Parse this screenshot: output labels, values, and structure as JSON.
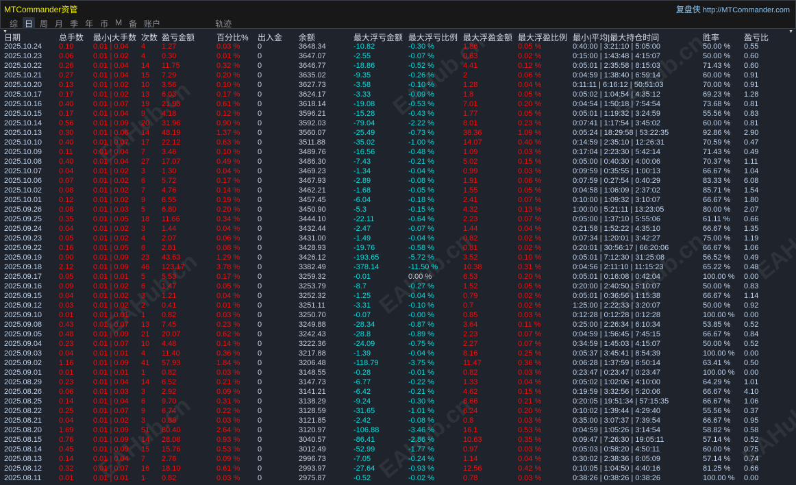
{
  "app": {
    "title": "MTCommander资管",
    "brand_cn": "复盘侠",
    "brand_url": "http://MTCommander.com",
    "watermark": "EAHub.cn"
  },
  "tabs": [
    {
      "label": "综"
    },
    {
      "label": "日",
      "active": true
    },
    {
      "label": "周"
    },
    {
      "label": "月"
    },
    {
      "label": "季"
    },
    {
      "label": "年"
    },
    {
      "label": "币"
    },
    {
      "label": "M"
    },
    {
      "label": "备"
    },
    {
      "label": "账户"
    },
    {
      "label": "轨迹"
    }
  ],
  "columns": [
    "日期",
    "总手数",
    "最小|大手数",
    "次数",
    "盈亏金额",
    "百分比%",
    "出入金",
    "余额",
    "最大浮亏金额",
    "最大浮亏比例",
    "最大浮盈金额",
    "最大浮盈比例",
    "最小|平均|最大持仓时间",
    "胜率",
    "盈亏比"
  ],
  "colors": {
    "positive": "#ee1111",
    "negative": "#10dcdc",
    "neutral": "#c0d4ee"
  },
  "rows": [
    [
      "2025.10.24",
      "0.10",
      "0.01 | 0.04",
      "4",
      "1.27",
      "0.03 %",
      "0",
      "3648.34",
      "-10.82",
      "-0.30 %",
      "1.86",
      "0.05 %",
      "0:40:00 | 3:21:10 | 5:05:00",
      "50.00 %",
      "0.55"
    ],
    [
      "2025.10.23",
      "0.06",
      "0.01 | 0.02",
      "4",
      "0.30",
      "0.01 %",
      "0",
      "3647.07",
      "-2.55",
      "-0.07 %",
      "0.63",
      "0.02 %",
      "0:15:00 | 1:43:48 | 4:15:07",
      "50.00 %",
      "0.60"
    ],
    [
      "2025.10.22",
      "0.26",
      "0.01 | 0.04",
      "14",
      "11.75",
      "0.32 %",
      "0",
      "3646.77",
      "-18.86",
      "-0.52 %",
      "4.41",
      "0.12 %",
      "0:05:01 | 2:35:58 | 8:15:03",
      "71.43 %",
      "0.60"
    ],
    [
      "2025.10.21",
      "0.27",
      "0.01 | 0.04",
      "15",
      "7.29",
      "0.20 %",
      "0",
      "3635.02",
      "-9.35",
      "-0.26 %",
      "2",
      "0.06 %",
      "0:04:59 | 1:38:40 | 6:59:14",
      "60.00 %",
      "0.91"
    ],
    [
      "2025.10.20",
      "0.13",
      "0.01 | 0.02",
      "10",
      "3.56",
      "0.10 %",
      "0",
      "3627.73",
      "-3.58",
      "-0.10 %",
      "1.28",
      "0.04 %",
      "0:11:11 | 6:16:12 | 50:51:03",
      "70.00 %",
      "0.91"
    ],
    [
      "2025.10.17",
      "0.17",
      "0.01 | 0.02",
      "13",
      "6.03",
      "0.17 %",
      "0",
      "3624.17",
      "-3.33",
      "-0.09 %",
      "1.8",
      "0.05 %",
      "0:05:02 | 1:04:54 | 4:35:12",
      "69.23 %",
      "1.28"
    ],
    [
      "2025.10.16",
      "0.40",
      "0.01 | 0.07",
      "19",
      "21.93",
      "0.61 %",
      "0",
      "3618.14",
      "-19.08",
      "-0.53 %",
      "7.01",
      "0.20 %",
      "0:04:54 | 1:50:18 | 7:54:54",
      "73.68 %",
      "0.81"
    ],
    [
      "2025.10.15",
      "0.17",
      "0.01 | 0.04",
      "9",
      "4.18",
      "0.12 %",
      "0",
      "3596.21",
      "-15.28",
      "-0.43 %",
      "1.77",
      "0.05 %",
      "0:05:01 | 1:19:32 | 3:24:59",
      "55.56 %",
      "0.83"
    ],
    [
      "2025.10.14",
      "0.56",
      "0.01 | 0.09",
      "20",
      "31.96",
      "0.90 %",
      "0",
      "3592.03",
      "-79.04",
      "-2.22 %",
      "8.01",
      "0.23 %",
      "0:07:41 | 1:17:54 | 3:45:02",
      "60.00 %",
      "0.81"
    ],
    [
      "2025.10.13",
      "0.30",
      "0.01 | 0.06",
      "14",
      "48.19",
      "1.37 %",
      "0",
      "3560.07",
      "-25.49",
      "-0.73 %",
      "38.36",
      "1.09 %",
      "0:05:24 | 18:29:58 | 53:22:35",
      "92.86 %",
      "2.90"
    ],
    [
      "2025.10.10",
      "0.40",
      "0.01 | 0.07",
      "17",
      "22.12",
      "0.63 %",
      "0",
      "3511.88",
      "-35.02",
      "-1.00 %",
      "14.07",
      "0.40 %",
      "0:14:59 | 2:35:10 | 12:26:31",
      "70.59 %",
      "0.47"
    ],
    [
      "2025.10.09",
      "0.11",
      "0.01 | 0.04",
      "7",
      "3.46",
      "0.10 %",
      "0",
      "3489.76",
      "-16.56",
      "-0.48 %",
      "1.09",
      "0.03 %",
      "0:17:04 | 2:23:30 | 5:42:14",
      "71.43 %",
      "0.49"
    ],
    [
      "2025.10.08",
      "0.40",
      "0.01 | 0.04",
      "27",
      "17.07",
      "0.49 %",
      "0",
      "3486.30",
      "-7.43",
      "-0.21 %",
      "5.02",
      "0.15 %",
      "0:05:00 | 0:40:30 | 4:00:06",
      "70.37 %",
      "1.11"
    ],
    [
      "2025.10.07",
      "0.04",
      "0.01 | 0.02",
      "3",
      "1.30",
      "0.04 %",
      "0",
      "3469.23",
      "-1.34",
      "-0.04 %",
      "0.99",
      "0.03 %",
      "0:09:59 | 0:35:55 | 1:00:13",
      "66.67 %",
      "1.04"
    ],
    [
      "2025.10.06",
      "0.07",
      "0.01 | 0.02",
      "6",
      "5.72",
      "0.17 %",
      "0",
      "3467.93",
      "-2.89",
      "-0.08 %",
      "1.91",
      "0.06 %",
      "0:07:59 | 0:27:54 | 0:40:29",
      "83.33 %",
      "6.08"
    ],
    [
      "2025.10.02",
      "0.08",
      "0.01 | 0.02",
      "7",
      "4.76",
      "0.14 %",
      "0",
      "3462.21",
      "-1.68",
      "-0.05 %",
      "1.55",
      "0.05 %",
      "0:04:58 | 1:06:09 | 2:37:02",
      "85.71 %",
      "1.54"
    ],
    [
      "2025.10.01",
      "0.12",
      "0.01 | 0.02",
      "9",
      "6.55",
      "0.19 %",
      "0",
      "3457.45",
      "-6.04",
      "-0.18 %",
      "2.41",
      "0.07 %",
      "0:10:00 | 1:09:32 | 3:10:07",
      "66.67 %",
      "1.80"
    ],
    [
      "2025.09.26",
      "0.08",
      "0.01 | 0.03",
      "5",
      "6.80",
      "0.20 %",
      "0",
      "3450.90",
      "-5.3",
      "-0.15 %",
      "4.32",
      "0.13 %",
      "1:00:00 | 5:21:11 | 13:23:05",
      "80.00 %",
      "2.07"
    ],
    [
      "2025.09.25",
      "0.35",
      "0.01 | 0.05",
      "18",
      "11.66",
      "0.34 %",
      "0",
      "3444.10",
      "-22.11",
      "-0.64 %",
      "2.23",
      "0.07 %",
      "0:05:00 | 1:37:10 | 5:55:06",
      "61.11 %",
      "0.66"
    ],
    [
      "2025.09.24",
      "0.04",
      "0.01 | 0.02",
      "3",
      "1.44",
      "0.04 %",
      "0",
      "3432.44",
      "-2.47",
      "-0.07 %",
      "1.44",
      "0.04 %",
      "0:21:58 | 1:52:22 | 4:35:10",
      "66.67 %",
      "1.35"
    ],
    [
      "2025.09.23",
      "0.05",
      "0.01 | 0.02",
      "4",
      "2.07",
      "0.06 %",
      "0",
      "3431.00",
      "-1.49",
      "-0.04 %",
      "0.82",
      "0.02 %",
      "0:07:34 | 1:20:01 | 3:42:27",
      "75.00 %",
      "1.19"
    ],
    [
      "2025.09.22",
      "0.16",
      "0.01 | 0.05",
      "6",
      "2.81",
      "0.08 %",
      "0",
      "3428.93",
      "-19.76",
      "-0.58 %",
      "0.81",
      "0.02 %",
      "0:20:01 | 30:56:17 | 66:20:06",
      "66.67 %",
      "1.06"
    ],
    [
      "2025.09.19",
      "0.90",
      "0.01 | 0.09",
      "23",
      "43.63",
      "1.29 %",
      "0",
      "3426.12",
      "-193.65",
      "-5.72 %",
      "3.52",
      "0.10 %",
      "0:05:01 | 7:12:30 | 31:25:08",
      "56.52 %",
      "0.49"
    ],
    [
      "2025.09.18",
      "2.12",
      "0.01 | 0.09",
      "46",
      "123.17",
      "3.78 %",
      "0",
      "3382.49",
      "-378.14",
      "-11.50 %",
      "10.38",
      "0.31 %",
      "0:04:56 | 2:11:10 | 11:15:23",
      "65.22 %",
      "0.48"
    ],
    [
      "2025.09.17",
      "0.05",
      "0.01 | 0.01",
      "5",
      "5.53",
      "0.17 %",
      "0",
      "3259.32",
      "-0.01",
      "0.00 %",
      "6.53",
      "0.20 %",
      "0:05:01 | 0:16:08 | 0:42:04",
      "100.00 %",
      "0.00"
    ],
    [
      "2025.09.16",
      "0.09",
      "0.01 | 0.02",
      "6",
      "1.47",
      "0.05 %",
      "0",
      "3253.79",
      "-8.7",
      "-0.27 %",
      "1.52",
      "0.05 %",
      "0:20:00 | 2:40:50 | 5:10:07",
      "50.00 %",
      "0.83"
    ],
    [
      "2025.09.15",
      "0.04",
      "0.01 | 0.02",
      "3",
      "1.21",
      "0.04 %",
      "0",
      "3252.32",
      "-1.25",
      "-0.04 %",
      "0.79",
      "0.02 %",
      "0:05:01 | 0:36:56 | 1:15:38",
      "66.67 %",
      "1.14"
    ],
    [
      "2025.09.12",
      "0.03",
      "0.01 | 0.02",
      "2",
      "0.41",
      "0.01 %",
      "0",
      "3251.11",
      "-3.31",
      "-0.10 %",
      "0.7",
      "0.02 %",
      "1:25:00 | 2:22:33 | 3:20:07",
      "50.00 %",
      "0.92"
    ],
    [
      "2025.09.10",
      "0.01",
      "0.01 | 0.01",
      "1",
      "0.82",
      "0.03 %",
      "0",
      "3250.70",
      "-0.07",
      "-0.00 %",
      "0.85",
      "0.03 %",
      "0:12:28 | 0:12:28 | 0:12:28",
      "100.00 %",
      "0.00"
    ],
    [
      "2025.09.08",
      "0.43",
      "0.01 | 0.07",
      "13",
      "7.45",
      "0.23 %",
      "0",
      "3249.88",
      "-28.34",
      "-0.87 %",
      "3.64",
      "0.11 %",
      "0:25:00 | 2:26:34 | 6:10:34",
      "53.85 %",
      "0.52"
    ],
    [
      "2025.09.05",
      "0.48",
      "0.01 | 0.09",
      "21",
      "20.07",
      "0.62 %",
      "0",
      "3242.43",
      "-28.8",
      "-0.89 %",
      "2.23",
      "0.07 %",
      "0:04:59 | 1:56:45 | 7:45:15",
      "66.67 %",
      "0.84"
    ],
    [
      "2025.09.04",
      "0.23",
      "0.01 | 0.07",
      "10",
      "4.48",
      "0.14 %",
      "0",
      "3222.36",
      "-24.09",
      "-0.75 %",
      "2.27",
      "0.07 %",
      "0:34:59 | 1:45:03 | 4:15:07",
      "50.00 %",
      "0.52"
    ],
    [
      "2025.09.03",
      "0.04",
      "0.01 | 0.01",
      "4",
      "11.40",
      "0.36 %",
      "0",
      "3217.88",
      "-1.39",
      "-0.04 %",
      "8.16",
      "0.25 %",
      "0:05:37 | 3:45:41 | 8:54:39",
      "100.00 %",
      "0.00"
    ],
    [
      "2025.09.02",
      "1.16",
      "0.01 | 0.09",
      "41",
      "57.93",
      "1.84 %",
      "0",
      "3206.48",
      "-118.79",
      "-3.75 %",
      "11.47",
      "0.36 %",
      "0:06:28 | 1:37:59 | 6:50:14",
      "63.41 %",
      "0.50"
    ],
    [
      "2025.09.01",
      "0.01",
      "0.01 | 0.01",
      "1",
      "0.82",
      "0.03 %",
      "0",
      "3148.55",
      "-0.28",
      "-0.01 %",
      "0.82",
      "0.03 %",
      "0:23:47 | 0:23:47 | 0:23:47",
      "100.00 %",
      "0.00"
    ],
    [
      "2025.08.29",
      "0.23",
      "0.01 | 0.04",
      "14",
      "6.52",
      "0.21 %",
      "0",
      "3147.73",
      "-6.77",
      "-0.22 %",
      "1.33",
      "0.04 %",
      "0:05:02 | 1:02:06 | 4:10:00",
      "64.29 %",
      "1.01"
    ],
    [
      "2025.08.26",
      "0.06",
      "0.01 | 0.03",
      "3",
      "2.92",
      "0.09 %",
      "0",
      "3141.21",
      "-6.42",
      "-0.21 %",
      "4.62",
      "0.15 %",
      "0:19:59 | 3:32:56 | 5:20:06",
      "66.67 %",
      "4.10"
    ],
    [
      "2025.08.25",
      "0.14",
      "0.01 | 0.04",
      "6",
      "9.70",
      "0.31 %",
      "0",
      "3138.29",
      "-9.24",
      "-0.30 %",
      "6.66",
      "0.21 %",
      "0:20:05 | 19:51:34 | 57:15:35",
      "66.67 %",
      "1.06"
    ],
    [
      "2025.08.22",
      "0.25",
      "0.01 | 0.07",
      "9",
      "6.74",
      "0.22 %",
      "0",
      "3128.59",
      "-31.65",
      "-1.01 %",
      "6.24",
      "0.20 %",
      "0:10:02 | 1:39:44 | 4:29:40",
      "55.56 %",
      "0.37"
    ],
    [
      "2025.08.21",
      "0.04",
      "0.01 | 0.02",
      "3",
      "0.88",
      "0.03 %",
      "0",
      "3121.85",
      "-2.42",
      "-0.08 %",
      "0.8",
      "0.03 %",
      "0:35:00 | 3:07:37 | 7:39:54",
      "66.67 %",
      "0.95"
    ],
    [
      "2025.08.20",
      "1.69",
      "0.01 | 0.09",
      "51",
      "80.40",
      "2.64 %",
      "0",
      "3120.97",
      "-106.88",
      "-3.46 %",
      "16.1",
      "0.53 %",
      "0:04:59 | 1:05:26 | 3:14:54",
      "58.82 %",
      "0.58"
    ],
    [
      "2025.08.15",
      "0.76",
      "0.01 | 0.09",
      "14",
      "28.08",
      "0.93 %",
      "0",
      "3040.57",
      "-86.41",
      "-2.86 %",
      "10.63",
      "0.35 %",
      "0:09:47 | 7:26:30 | 19:05:11",
      "57.14 %",
      "0.52"
    ],
    [
      "2025.08.14",
      "0.45",
      "0.01 | 0.09",
      "15",
      "15.76",
      "0.53 %",
      "0",
      "3012.49",
      "-52.99",
      "-1.77 %",
      "0.97",
      "0.03 %",
      "0:05:03 | 0:58:20 | 4:50:11",
      "60.00 %",
      "0.75"
    ],
    [
      "2025.08.13",
      "0.14",
      "0.01 | 0.04",
      "7",
      "2.76",
      "0.09 %",
      "0",
      "2996.73",
      "-7.05",
      "-0.24 %",
      "1.14",
      "0.04 %",
      "0:30:02 | 2:38:36 | 6:05:09",
      "57.14 %",
      "0.74"
    ],
    [
      "2025.08.12",
      "0.32",
      "0.01 | 0.07",
      "16",
      "18.10",
      "0.61 %",
      "0",
      "2993.97",
      "-27.64",
      "-0.93 %",
      "12.56",
      "0.42 %",
      "0:10:05 | 1:04:50 | 4:40:16",
      "81.25 %",
      "0.66"
    ],
    [
      "2025.08.11",
      "0.01",
      "0.01 | 0.01",
      "1",
      "0.82",
      "0.03 %",
      "0",
      "2975.87",
      "-0.52",
      "-0.02 %",
      "0.78",
      "0.03 %",
      "0:38:26 | 0:38:26 | 0:38:26",
      "100.00 %",
      "0.00"
    ]
  ]
}
